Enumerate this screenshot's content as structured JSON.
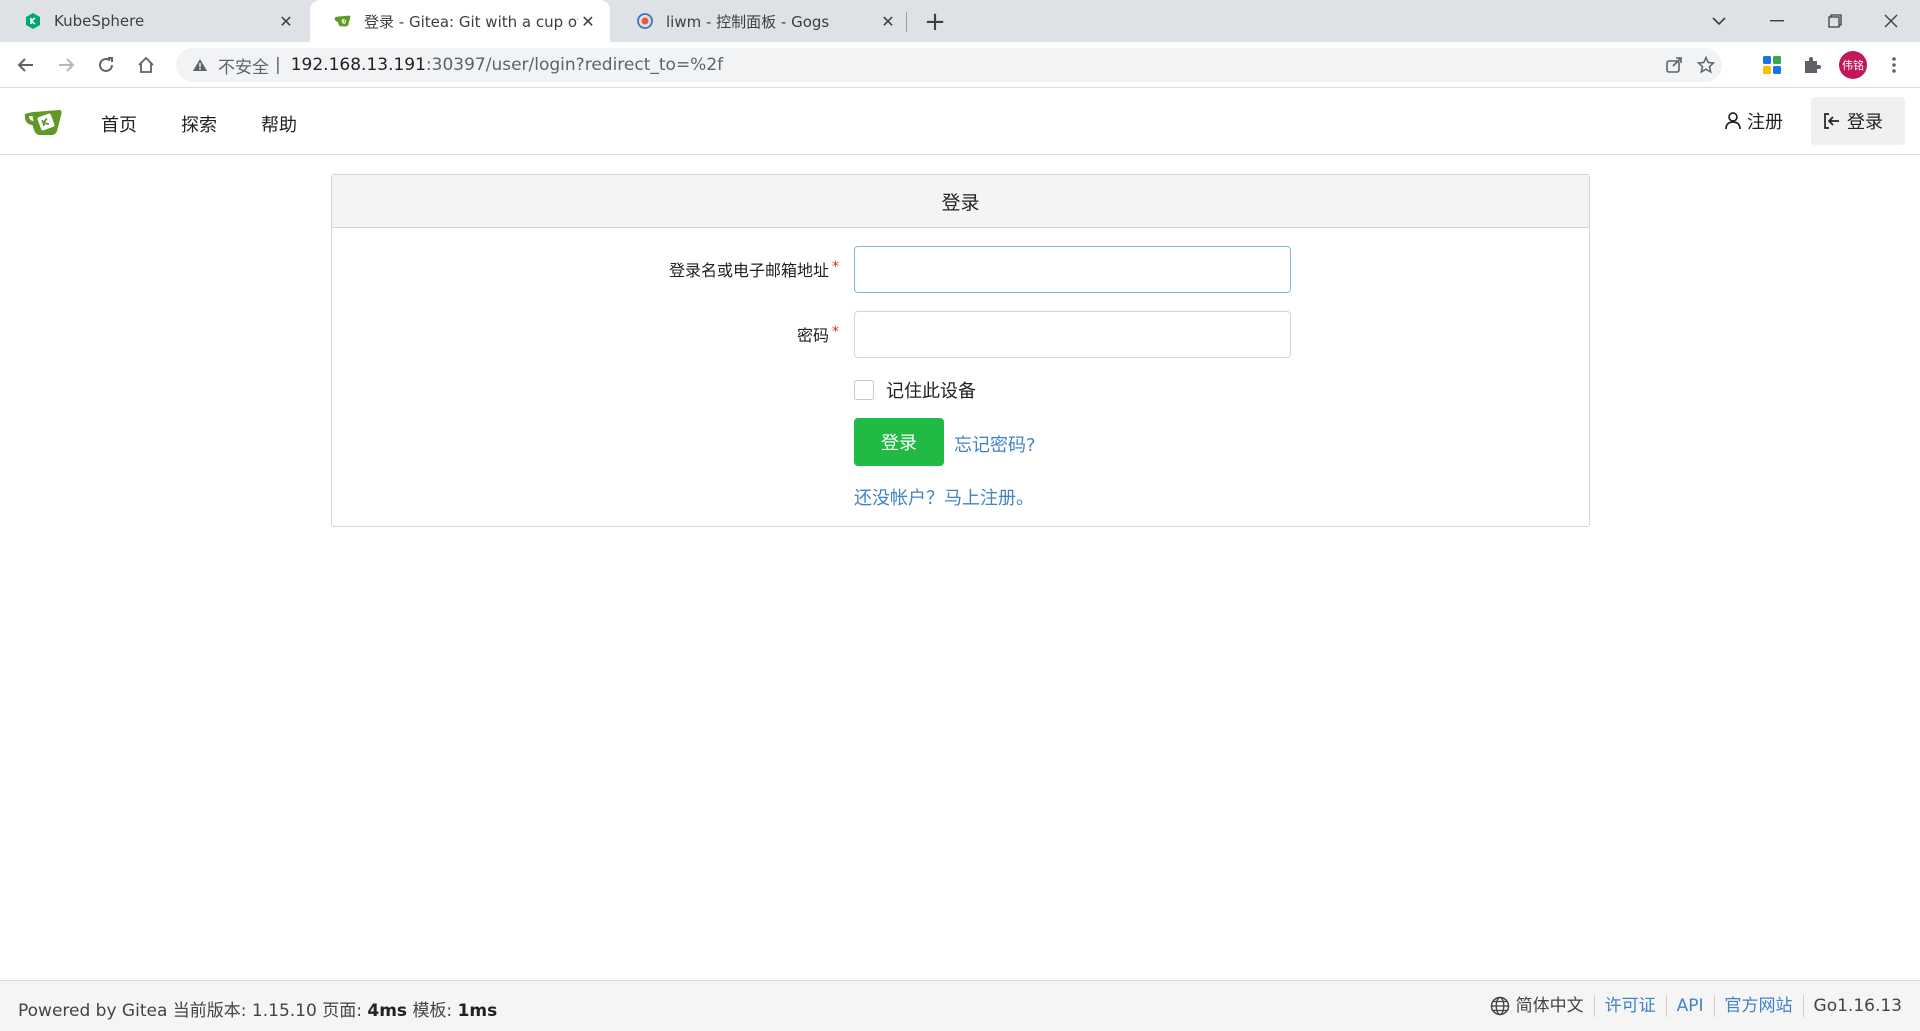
{
  "browser": {
    "tabs": [
      {
        "title": "KubeSphere",
        "icon": "kubesphere-icon"
      },
      {
        "title": "登录 - Gitea: Git with a cup of t",
        "icon": "gitea-icon"
      },
      {
        "title": "liwm - 控制面板 - Gogs",
        "icon": "gogs-icon"
      }
    ],
    "address": {
      "security": "不安全",
      "host": "192.168.13.191",
      "rest": ":30397/user/login?redirect_to=%2f"
    },
    "profile_initials": "伟铭"
  },
  "nav": {
    "home": "首页",
    "explore": "探索",
    "help": "帮助",
    "register": "注册",
    "login": "登录"
  },
  "login_form": {
    "title": "登录",
    "username_label": "登录名或电子邮箱地址",
    "username_value": "",
    "password_label": "密码",
    "password_value": "",
    "required_mark": "*",
    "remember_label": "记住此设备",
    "remember_checked": false,
    "submit_label": "登录",
    "forgot_label": "忘记密码?",
    "register_prompt": "还没帐户？马上注册。"
  },
  "footer": {
    "powered_by": "Powered by Gitea",
    "version_label": "当前版本:",
    "version": "1.15.10",
    "page_label": "页面:",
    "page_time": "4ms",
    "template_label": "模板:",
    "template_time": "1ms",
    "language": "简体中文",
    "license": "许可证",
    "api": "API",
    "website": "官方网站",
    "go_version": "Go1.16.13"
  },
  "colors": {
    "accent_green": "#21ba45",
    "link_blue": "#4183c4",
    "required_red": "#db2828"
  }
}
